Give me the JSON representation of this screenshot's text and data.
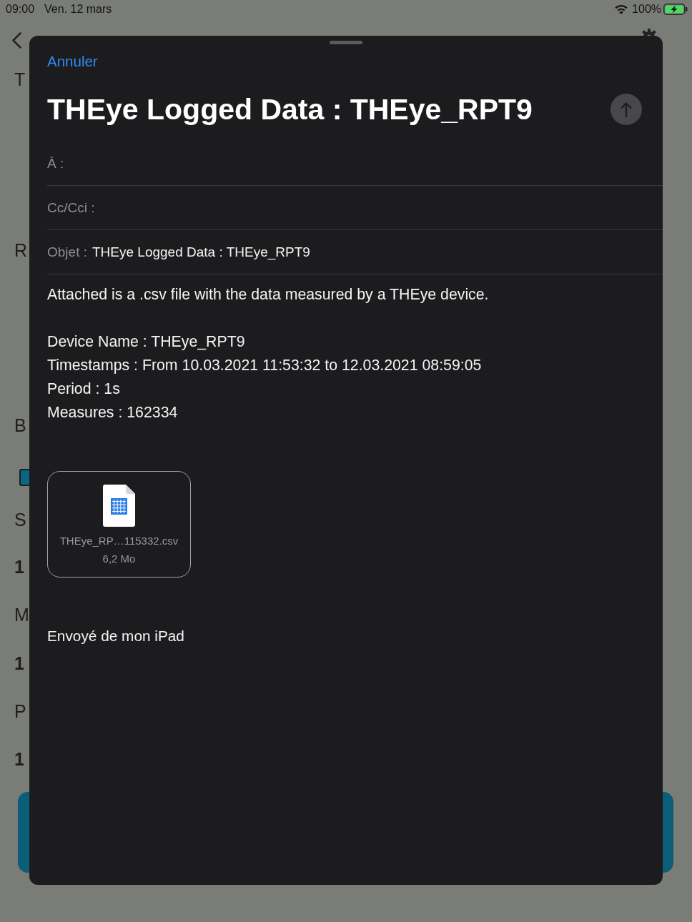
{
  "status_bar": {
    "time": "09:00",
    "date": "Ven. 12 mars",
    "battery_percent": "100%",
    "charging": true
  },
  "background_page": {
    "rows": [
      {
        "kind": "label",
        "text": "T"
      },
      {
        "kind": "label",
        "text": "R"
      },
      {
        "kind": "label",
        "text": "B"
      },
      {
        "kind": "checkbox",
        "checked": true
      },
      {
        "kind": "label",
        "text": "S"
      },
      {
        "kind": "value",
        "text": "1"
      },
      {
        "kind": "label",
        "text": "M"
      },
      {
        "kind": "value",
        "text": "1"
      },
      {
        "kind": "label",
        "text": "P"
      },
      {
        "kind": "value",
        "text": "1"
      }
    ]
  },
  "compose_sheet": {
    "cancel": "Annuler",
    "title": "THEye Logged Data : THEye_RPT9",
    "fields": [
      {
        "label": "À :"
      },
      {
        "label": "Cc/Cci :"
      },
      {
        "label": "Objet :",
        "value": "THEye Logged Data : THEye_RPT9"
      }
    ],
    "body": {
      "paragraphs": [
        [
          "Attached is a .csv file with the data measured by a THEye device."
        ],
        [
          "Device Name : THEye_RPT9",
          "Timestamps : From 10.03.2021 11:53:32 to 12.03.2021 08:59:05",
          "Period : 1s",
          "Measures : 162334"
        ]
      ]
    },
    "attachment": {
      "file_name": "THEye_RP…115332.csv",
      "size": "6,2 Mo"
    },
    "signature": "Envoyé de mon iPad"
  }
}
